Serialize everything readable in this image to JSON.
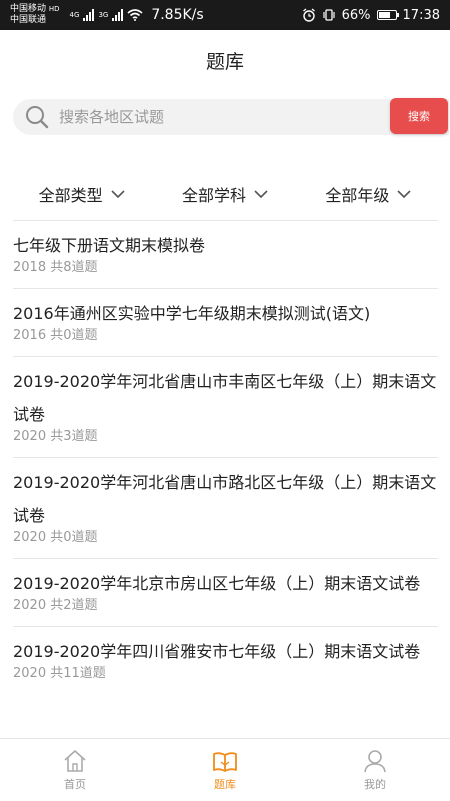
{
  "status_bar": {
    "carrier1": "中国移动",
    "carrier1_tag": "HD",
    "carrier2": "中国联通",
    "net1": "4G",
    "net2": "3G",
    "speed": "7.85K/s",
    "battery": "66%",
    "time": "17:38"
  },
  "header": {
    "title": "题库"
  },
  "search": {
    "placeholder": "搜索各地区试题",
    "button": "搜索"
  },
  "filters": [
    {
      "label": "全部类型"
    },
    {
      "label": "全部学科"
    },
    {
      "label": "全部年级"
    }
  ],
  "items": [
    {
      "title": "七年级下册语文期末模拟卷",
      "meta": "2018 共8道题"
    },
    {
      "title": "2016年通州区实验中学七年级期末模拟测试(语文)",
      "meta": "2016 共0道题"
    },
    {
      "title": "2019-2020学年河北省唐山市丰南区七年级（上）期末语文试卷",
      "meta": "2020 共3道题"
    },
    {
      "title": "2019-2020学年河北省唐山市路北区七年级（上）期末语文试卷",
      "meta": "2020 共0道题"
    },
    {
      "title": "2019-2020学年北京市房山区七年级（上）期末语文试卷",
      "meta": "2020 共2道题"
    },
    {
      "title": "2019-2020学年四川省雅安市七年级（上）期末语文试卷",
      "meta": "2020 共11道题"
    }
  ],
  "tabbar": [
    {
      "label": "首页",
      "icon": "home-icon"
    },
    {
      "label": "题库",
      "icon": "book-icon"
    },
    {
      "label": "我的",
      "icon": "user-icon"
    }
  ],
  "colors": {
    "accent": "#e84d4d",
    "tab_active": "#f08c1a",
    "meta": "#999999"
  }
}
